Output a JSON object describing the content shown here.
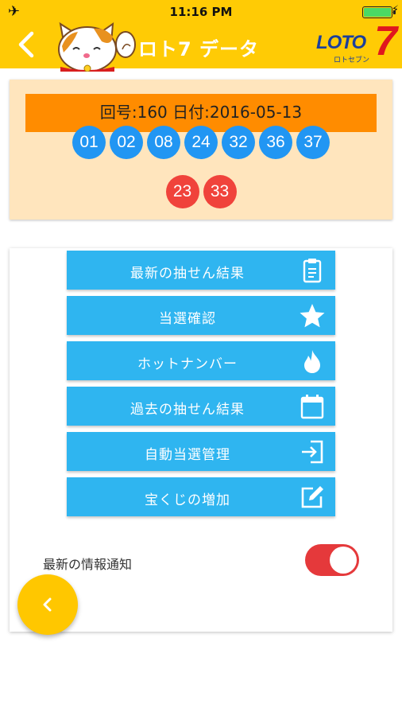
{
  "status_bar": {
    "time": "11:16 PM"
  },
  "header": {
    "title": "ロト7 データ",
    "logo_text": "LOTO",
    "logo_seven": "7",
    "logo_sub": "ロトセブン"
  },
  "latest_result": {
    "draw_info": "回号:160 日付:2016-05-13",
    "main_numbers": [
      "01",
      "02",
      "08",
      "24",
      "32",
      "36",
      "37"
    ],
    "bonus_numbers": [
      "23",
      "33"
    ]
  },
  "menu": {
    "items": [
      {
        "label": "最新の抽せん結果",
        "icon": "clipboard-icon"
      },
      {
        "label": "当選確認",
        "icon": "star-icon"
      },
      {
        "label": "ホットナンバー",
        "icon": "flame-icon"
      },
      {
        "label": "過去の抽せん結果",
        "icon": "calendar-icon"
      },
      {
        "label": "自動当選管理",
        "icon": "sign-in-icon"
      },
      {
        "label": "宝くじの増加",
        "icon": "edit-icon"
      }
    ]
  },
  "notification": {
    "label": "最新の情報通知",
    "enabled": true
  },
  "colors": {
    "header": "#ffcb05",
    "draw_bar": "#ff8c00",
    "card_bg": "#ffe5bd",
    "main_ball": "#2196f3",
    "bonus_ball": "#f0433b",
    "menu_button": "#2fb5f0",
    "toggle_on": "#e5393b",
    "fab": "#ffc700"
  }
}
